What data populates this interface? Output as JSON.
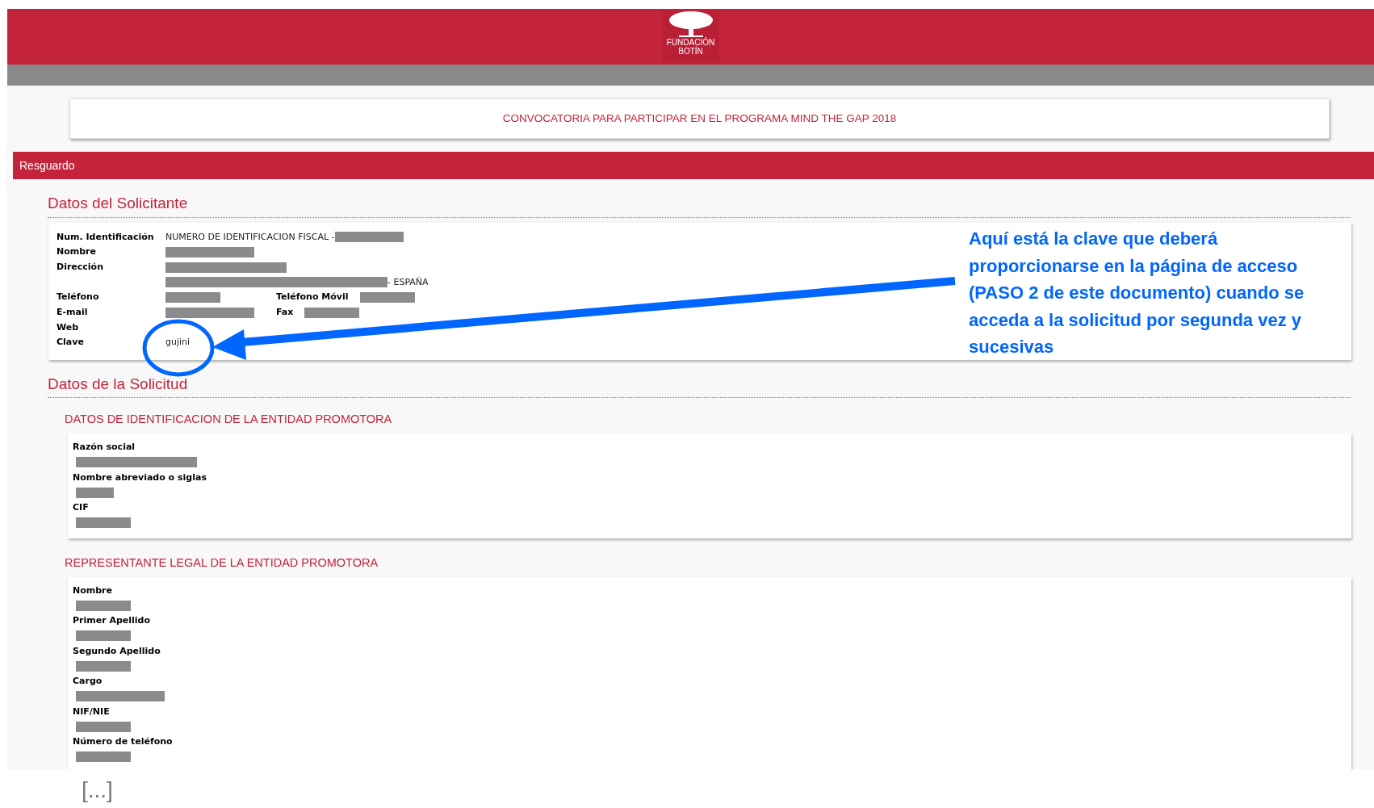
{
  "header": {
    "logo_lines": [
      "FUNDACIÓN",
      "BOTÍN"
    ]
  },
  "title_banner": "CONVOCATORIA PARA PARTICIPAR EN EL PROGRAMA MIND THE GAP 2018",
  "section_bar": "Resguardo",
  "applicant": {
    "title": "Datos del Solicitante",
    "rows": [
      {
        "label": "Num. Identificación",
        "parts": [
          {
            "kind": "text",
            "text": "NUMERO DE IDENTIFICACION FISCAL -"
          },
          {
            "kind": "redaction"
          }
        ]
      },
      {
        "label": "Nombre",
        "parts": [
          {
            "kind": "redaction"
          }
        ]
      },
      {
        "label": "Dirección",
        "parts": [
          {
            "kind": "redaction"
          }
        ]
      },
      {
        "label": "",
        "parts": [
          {
            "kind": "redaction"
          },
          {
            "kind": "text",
            "text": "- ESPAÑA"
          }
        ]
      },
      {
        "label": "Teléfono",
        "parts": [
          {
            "kind": "redaction"
          }
        ],
        "extra": {
          "label": "Teléfono Móvil",
          "parts": [
            {
              "kind": "redaction"
            }
          ]
        }
      },
      {
        "label": "E-mail",
        "parts": [
          {
            "kind": "redaction"
          }
        ],
        "extra": {
          "label": "Fax",
          "parts": [
            {
              "kind": "redaction"
            }
          ]
        }
      },
      {
        "label": "Web",
        "parts": []
      },
      {
        "label": "Clave",
        "parts": [
          {
            "kind": "text",
            "text": "gujini"
          }
        ]
      }
    ]
  },
  "request": {
    "title": "Datos de la Solicitud",
    "groups": [
      {
        "title": "DATOS DE IDENTIFICACION DE LA ENTIDAD PROMOTORA",
        "fields": [
          {
            "label": "Razón social"
          },
          {
            "label": "Nombre abreviado o siglas"
          },
          {
            "label": "CIF"
          }
        ]
      },
      {
        "title": "REPRESENTANTE LEGAL DE LA ENTIDAD PROMOTORA",
        "fields": [
          {
            "label": "Nombre"
          },
          {
            "label": "Primer Apellido"
          },
          {
            "label": "Segundo Apellido"
          },
          {
            "label": "Cargo"
          },
          {
            "label": "NIF/NIE"
          },
          {
            "label": "Número de teléfono"
          }
        ]
      }
    ]
  },
  "annotation": "Aquí está la clave que deberá proporcionarse en la página de acceso (PASO 2 de este documento) cuando se acceda a la solicitud por segunda vez y sucesivas",
  "ellipsis": "[...]"
}
